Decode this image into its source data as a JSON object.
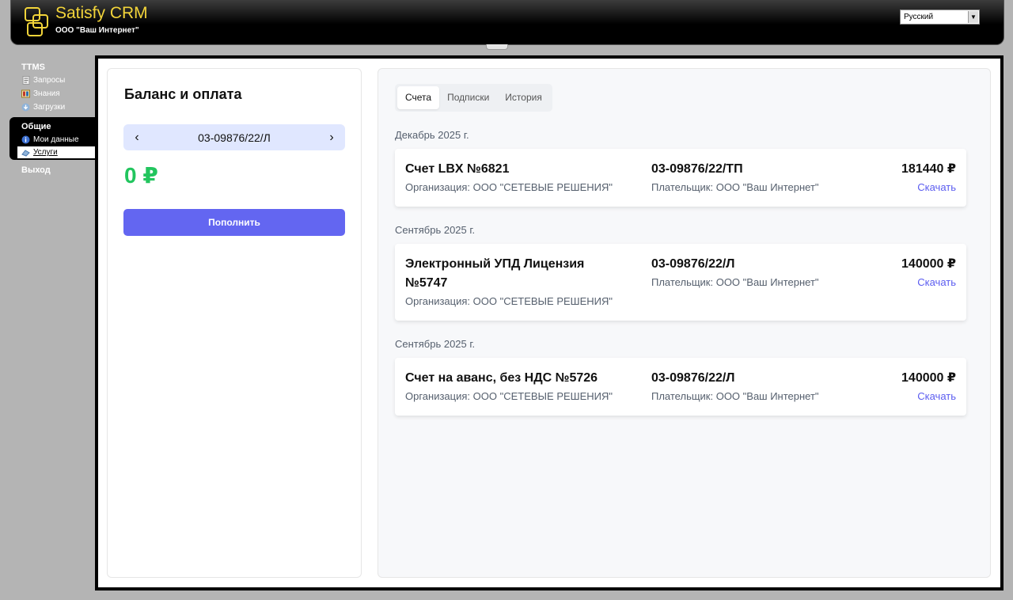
{
  "header": {
    "app_title": "Satisfy CRM",
    "org_name": "ООО \"Ваш Интернет\"",
    "language": "Русский"
  },
  "nav": {
    "group1_title": "TTMS",
    "group1_items": [
      {
        "label": "Запросы",
        "icon": "document-icon"
      },
      {
        "label": "Знания",
        "icon": "book-icon"
      },
      {
        "label": "Загрузки",
        "icon": "download-icon"
      }
    ],
    "group2_title": "Общие",
    "group2_items": [
      {
        "label": "Мои данные",
        "icon": "info-icon"
      },
      {
        "label": "Услуги",
        "icon": "services-icon"
      }
    ],
    "exit_label": "Выход"
  },
  "balance": {
    "title": "Баланс и оплата",
    "account": "03-09876/22/Л",
    "amount": "0 ₽",
    "topup_label": "Пополнить"
  },
  "tabs": [
    "Счета",
    "Подписки",
    "История"
  ],
  "invoices": [
    {
      "month": "Декабрь 2025 г.",
      "title": "Счет LBX №6821",
      "org": "Организация: ООО \"СЕТЕВЫЕ РЕШЕНИЯ\"",
      "account": "03-09876/22/ТП",
      "payer": "Плательщик: ООО \"Ваш Интернет\"",
      "sum": "181440 ₽",
      "download": "Скачать"
    },
    {
      "month": "Сентябрь 2025 г.",
      "title": "Электронный УПД Лицензия №5747",
      "org": "Организация: ООО \"СЕТЕВЫЕ РЕШЕНИЯ\"",
      "account": "03-09876/22/Л",
      "payer": "Плательщик: ООО \"Ваш Интернет\"",
      "sum": "140000 ₽",
      "download": "Скачать"
    },
    {
      "month": "Сентябрь 2025 г.",
      "title": "Счет на аванс, без НДС №5726",
      "org": "Организация: ООО \"СЕТЕВЫЕ РЕШЕНИЯ\"",
      "account": "03-09876/22/Л",
      "payer": "Плательщик: ООО \"Ваш Интернет\"",
      "sum": "140000 ₽",
      "download": "Скачать"
    }
  ],
  "colors": {
    "accent": "#6366f1",
    "balance_green": "#22c55e",
    "link": "#5b5cf0",
    "brand_yellow": "#f2d43a"
  }
}
